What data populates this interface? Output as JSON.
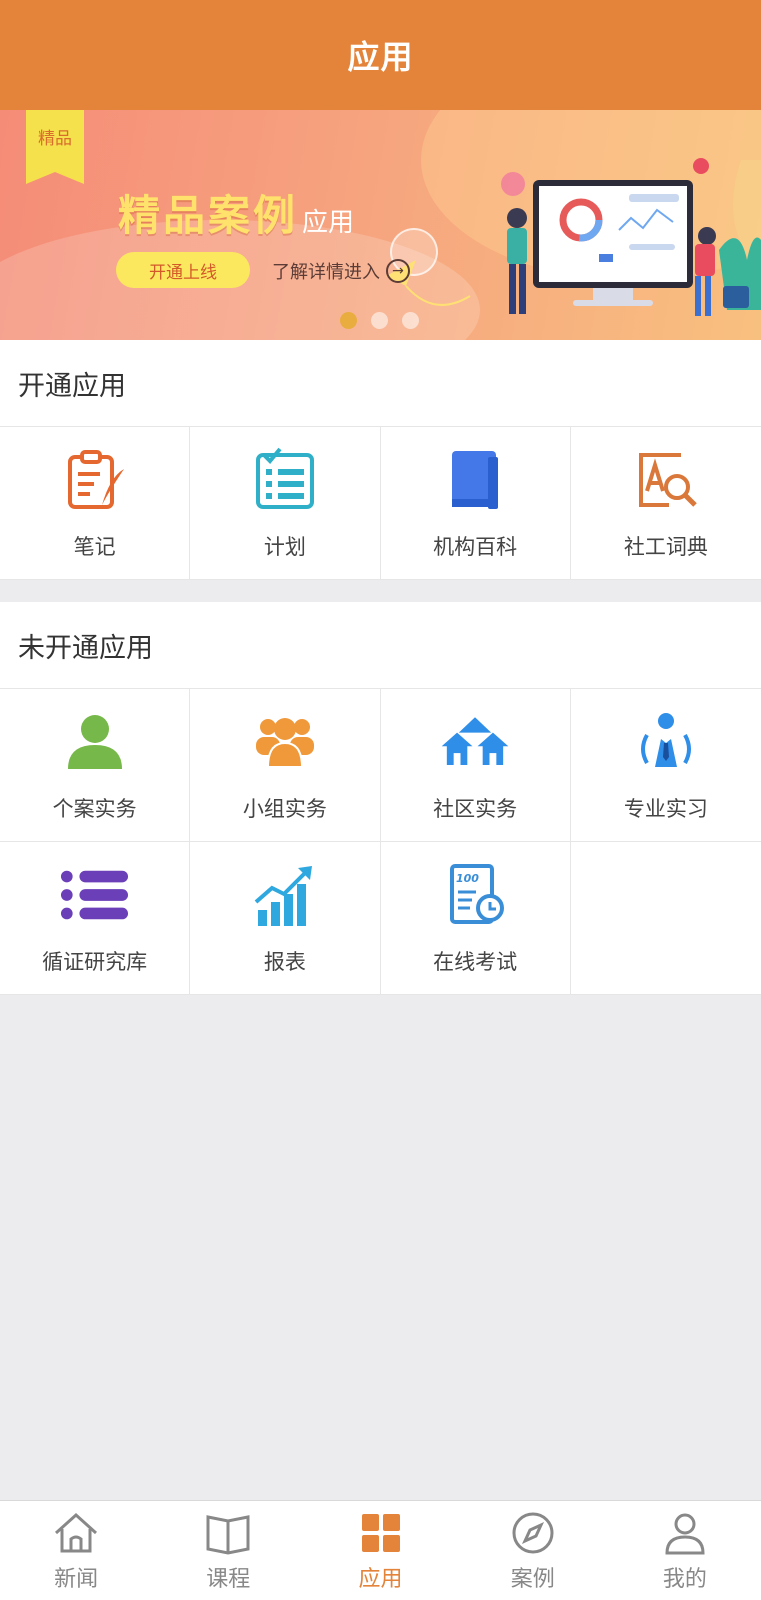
{
  "header": {
    "title": "应用"
  },
  "banner": {
    "ribbon": "精品",
    "headline": "精品案例",
    "headline_suffix": "应用",
    "cta_label": "开通上线",
    "detail_label": "了解详情进入",
    "active_dot": 1,
    "dot_count": 3
  },
  "enabled_section": {
    "title": "开通应用",
    "apps": [
      {
        "label": "笔记",
        "icon": "notes-icon"
      },
      {
        "label": "计划",
        "icon": "plan-checklist-icon"
      },
      {
        "label": "机构百科",
        "icon": "book-icon"
      },
      {
        "label": "社工词典",
        "icon": "dictionary-search-icon"
      }
    ]
  },
  "disabled_section": {
    "title": "未开通应用",
    "apps": [
      {
        "label": "个案实务",
        "icon": "person-icon"
      },
      {
        "label": "小组实务",
        "icon": "group-icon"
      },
      {
        "label": "社区实务",
        "icon": "community-houses-icon"
      },
      {
        "label": "专业实习",
        "icon": "professional-icon"
      },
      {
        "label": "循证研究库",
        "icon": "list-icon"
      },
      {
        "label": "报表",
        "icon": "report-chart-icon"
      },
      {
        "label": "在线考试",
        "icon": "exam-icon"
      }
    ]
  },
  "tabbar": {
    "tabs": [
      {
        "label": "新闻",
        "icon": "home-icon",
        "active": false
      },
      {
        "label": "课程",
        "icon": "open-book-icon",
        "active": false
      },
      {
        "label": "应用",
        "icon": "grid-icon",
        "active": true
      },
      {
        "label": "案例",
        "icon": "compass-icon",
        "active": false
      },
      {
        "label": "我的",
        "icon": "user-icon",
        "active": false
      }
    ]
  },
  "colors": {
    "header": "#e4833a",
    "accent": "#e4833a",
    "background": "#ececee"
  }
}
